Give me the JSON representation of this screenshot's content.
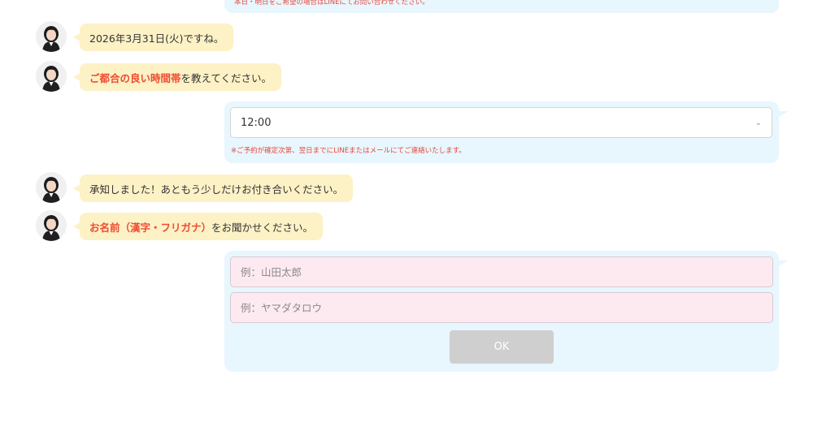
{
  "top_note": "本日・明日をご希望の場合はLINEにてお問い合わせください。",
  "messages": {
    "date_confirm": "2026年3月31日(火)ですね。",
    "time_prompt_highlight": "ご都合の良い時間帯",
    "time_prompt_rest": "を教えてください。",
    "acknowledge": "承知しました！あともう少しだけお付き合いください。",
    "name_prompt_highlight": "お名前（漢字・フリガナ）",
    "name_prompt_rest": "をお聞かせください。"
  },
  "time_select": {
    "value": "12:00",
    "note": "※ご予約が確定次第、翌日までにLINEまたはメールにてご連絡いたします。"
  },
  "name_form": {
    "kanji_placeholder": "例：山田太郎",
    "furigana_placeholder": "例：ヤマダタロウ",
    "ok_label": "OK"
  },
  "colors": {
    "operator_bubble": "#fdf1c6",
    "user_panel": "#e8f6fd",
    "highlight": "#ef4c2f",
    "input_bg": "#fdeaf1",
    "ok_button_disabled": "#cfcfcf"
  },
  "icons": {
    "avatar": "operator-avatar-icon",
    "select_arrow": "chevron-down-icon"
  }
}
